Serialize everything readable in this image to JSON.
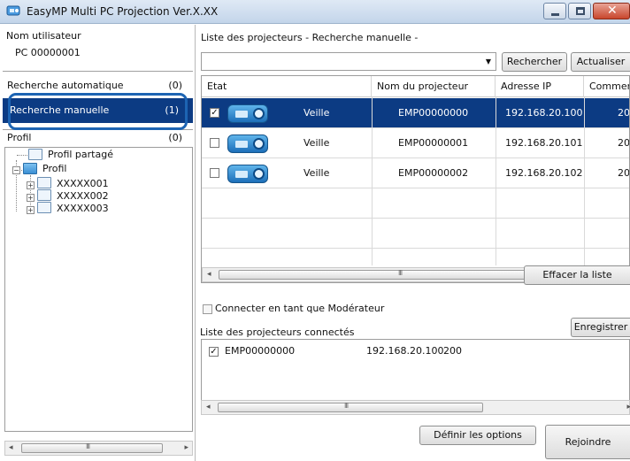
{
  "window": {
    "title": "EasyMP Multi PC Projection Ver.X.XX"
  },
  "left_panel": {
    "user_label": "Nom utilisateur",
    "user_value": "PC 00000001",
    "search_items": [
      {
        "label": "Recherche automatique",
        "count": "(0)"
      },
      {
        "label": "Recherche manuelle",
        "count": "(1)"
      },
      {
        "label": "Profil",
        "count": "(0)"
      }
    ],
    "tree": {
      "shared_profile": "Profil partagé",
      "profile": "Profil",
      "children": [
        "XXXXX001",
        "XXXXX002",
        "XXXXX003"
      ]
    },
    "scroll_grip": "III"
  },
  "right_panel": {
    "title": "Liste des projecteurs - Recherche manuelle -",
    "search_value": "",
    "search_button": "Rechercher",
    "refresh_button": "Actualiser",
    "columns": [
      "Etat",
      "Nom du projecteur",
      "Adresse IP",
      "Comment"
    ],
    "rows": [
      {
        "checked": true,
        "status": "Veille",
        "name": "EMP00000000",
        "ip": "192.168.20.100",
        "comment": "20"
      },
      {
        "checked": false,
        "status": "Veille",
        "name": "EMP00000001",
        "ip": "192.168.20.101",
        "comment": "20"
      },
      {
        "checked": false,
        "status": "Veille",
        "name": "EMP00000002",
        "ip": "192.168.20.102",
        "comment": "20"
      }
    ],
    "scroll_grip": "III",
    "clear_button": "Effacer la liste",
    "moderator_label": "Connecter en tant que Modérateur",
    "connected_label": "Liste des projecteurs connectés",
    "save_button": "Enregistrer",
    "connected": [
      {
        "checked": true,
        "name": "EMP00000000",
        "ip": "192.168.20.100",
        "comment": "200"
      }
    ],
    "options_button": "Définir les options",
    "join_button": "Rejoindre"
  },
  "colors": {
    "selection": "#0c3b83",
    "highlight_ring": "#1d64b3"
  },
  "icons": [
    "app-icon",
    "minimize-icon",
    "maximize-icon",
    "close-icon",
    "folder-icon",
    "projector-icon",
    "dropdown-arrow-icon"
  ]
}
